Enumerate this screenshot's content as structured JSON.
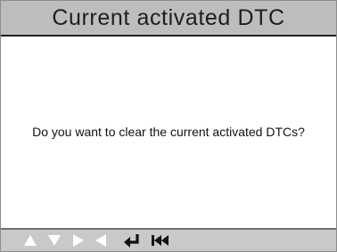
{
  "screen": {
    "title": "Current activated DTC",
    "message": "Do you want to clear the current activated DTCs?"
  },
  "colors": {
    "title_bar_bg": "#bdbdbd",
    "bottom_bar_bg": "#c9c9c9",
    "inactive_key": "#ffffff",
    "active_key": "#111111"
  },
  "bottom_bar": {
    "keys": [
      {
        "icon": "up-arrow-icon",
        "active": false
      },
      {
        "icon": "down-arrow-icon",
        "active": false
      },
      {
        "icon": "right-arrow-icon",
        "active": false
      },
      {
        "icon": "left-arrow-icon",
        "active": false
      },
      {
        "icon": "enter-icon",
        "active": true
      },
      {
        "icon": "back-to-start-icon",
        "active": true
      }
    ]
  }
}
